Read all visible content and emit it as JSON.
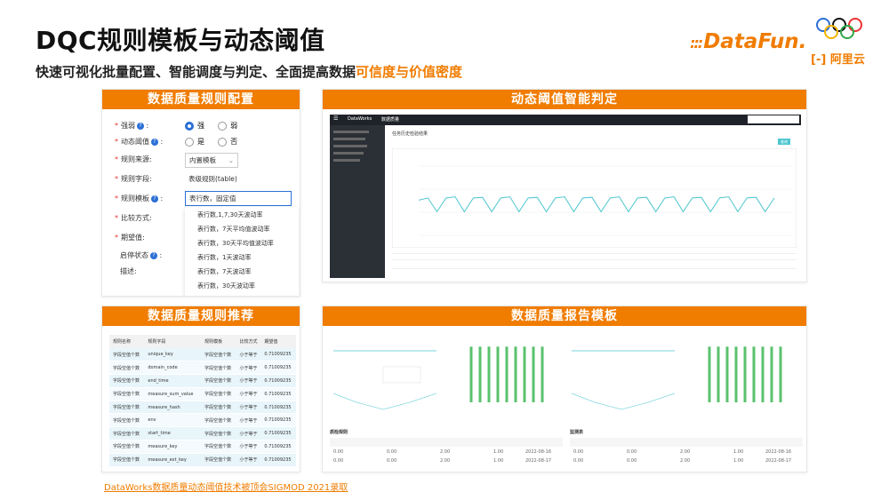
{
  "page": {
    "title": "DQC规则模板与动态阈值",
    "subtitle_prefix": "快速可视化批量配置、智能调度与判定、全面提高数据",
    "subtitle_highlight": "可信度与价值密度",
    "footer_link": "DataWorks数据质量动态阈值技术被顶会SIGMOD 2021录取"
  },
  "logos": {
    "datafun": "DataFun.",
    "aliyun": "阿里云"
  },
  "colors": {
    "accent": "#f07c00",
    "chart_line": "#4ec6cf",
    "bar_green": "#5ac26d",
    "radio_blue": "#2b6fd6"
  },
  "panels": {
    "rule_config": {
      "header": "数据质量规则配置",
      "strength_label": "强弱",
      "strength_opt1": "强",
      "strength_opt2": "弱",
      "dynamic_label": "动态阈值",
      "dynamic_opt1": "是",
      "dynamic_opt2": "否",
      "source_label": "规则来源:",
      "source_value": "内置模板",
      "field_label": "规则字段:",
      "field_value": "表级规则(table)",
      "template_label": "规则模板",
      "template_value": "表行数，固定值",
      "compare_label": "比较方式:",
      "expect_label": "期望值:",
      "status_label": "启停状态",
      "desc_label": "描述:",
      "menu_items": [
        "表行数,1,7,30天波动率",
        "表行数，7天平均值波动率",
        "表行数，30天平均值波动率",
        "表行数，1天波动率",
        "表行数，7天波动率",
        "表行数，30天波动率"
      ]
    },
    "dynamic_threshold": {
      "header": "动态阈值智能判定",
      "app_name": "DataWorks",
      "breadcrumb": "数据质量",
      "page_heading": "任务历史检验结果",
      "run_button": "查询"
    },
    "rule_recommend": {
      "header": "数据质量规则推荐",
      "columns": [
        "规则名称",
        "规则字段",
        "规则模板",
        "比较方式",
        "期望值"
      ],
      "rows": [
        [
          "字段空值个数",
          "unique_key",
          "字段空值个数",
          "小于等于",
          "0.71009235"
        ],
        [
          "字段空值个数",
          "domain_code",
          "字段空值个数",
          "小于等于",
          "0.71009235"
        ],
        [
          "字段空值个数",
          "end_time",
          "字段空值个数",
          "小于等于",
          "0.71009235"
        ],
        [
          "字段空值个数",
          "measure_sum_value",
          "字段空值个数",
          "小于等于",
          "0.71009235"
        ],
        [
          "字段空值个数",
          "measure_hash",
          "字段空值个数",
          "小于等于",
          "0.71009235"
        ],
        [
          "字段空值个数",
          "env",
          "字段空值个数",
          "小于等于",
          "0.71009235"
        ],
        [
          "字段空值个数",
          "start_time",
          "字段空值个数",
          "小于等于",
          "0.71009235"
        ],
        [
          "字段空值个数",
          "measure_key",
          "字段空值个数",
          "小于等于",
          "0.71009235"
        ],
        [
          "字段空值个数",
          "measure_ext_key",
          "字段空值个数",
          "小于等于",
          "0.71009235"
        ]
      ]
    },
    "report_template": {
      "header": "数据质量报告模板",
      "table1_title": "质检规则",
      "table2_title": "监测表",
      "table1_rows": [
        [
          "0.00",
          "0.00",
          "2.00",
          "1.00",
          "2022-08-16"
        ],
        [
          "0.00",
          "0.00",
          "2.00",
          "1.00",
          "2022-08-17"
        ]
      ],
      "table2_rows": [
        [
          "0.00",
          "0.00",
          "2.00",
          "1.00",
          "2022-08-16"
        ],
        [
          "0.00",
          "0.00",
          "2.00",
          "1.00",
          "2022-08-17"
        ]
      ]
    }
  },
  "chart_data": [
    {
      "type": "line",
      "values": [
        720,
        760,
        520,
        760,
        780,
        520,
        760,
        770,
        520,
        760,
        780,
        520,
        760,
        770,
        520,
        760,
        780,
        520,
        760,
        770,
        520,
        760,
        780,
        520,
        760,
        770,
        520,
        760,
        780,
        520,
        760,
        770,
        520,
        760,
        780,
        520,
        760,
        770,
        520,
        760
      ],
      "ylim": [
        0,
        1500
      ]
    },
    {
      "type": "bar",
      "values": [
        95,
        95,
        95,
        95,
        95,
        95,
        95,
        95,
        95
      ],
      "ylim": [
        0,
        100
      ]
    },
    {
      "type": "bar",
      "values": [
        95,
        95,
        95,
        95,
        95,
        95,
        95,
        95,
        95
      ],
      "ylim": [
        0,
        100
      ]
    }
  ]
}
